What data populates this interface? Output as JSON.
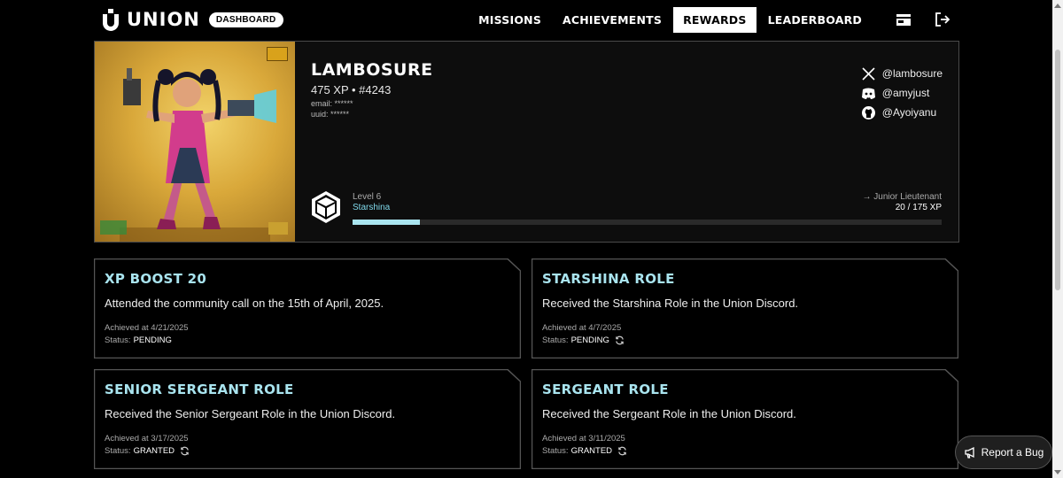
{
  "brand": {
    "name": "UNION",
    "tag": "DASHBOARD"
  },
  "nav": {
    "items": [
      {
        "label": "MISSIONS",
        "active": false
      },
      {
        "label": "ACHIEVEMENTS",
        "active": false
      },
      {
        "label": "REWARDS",
        "active": true
      },
      {
        "label": "LEADERBOARD",
        "active": false
      }
    ],
    "icons": [
      "wallet-icon",
      "logout-icon"
    ]
  },
  "profile": {
    "name": "LAMBOSURE",
    "xp_line": "475 XP • #4243",
    "email": "email: ******",
    "uuid": "uuid:  ******",
    "socials": [
      {
        "icon": "x-icon",
        "handle": "@lambosure"
      },
      {
        "icon": "discord-icon",
        "handle": "@amyjust"
      },
      {
        "icon": "github-icon",
        "handle": "@Ayoiyanu"
      }
    ],
    "level": "Level 6",
    "rank": "Starshina",
    "next_rank": "→ Junior Lieutenant",
    "xp_progress": "20 / 175 XP",
    "progress_fraction": 0.114
  },
  "cards": [
    {
      "title": "XP BOOST 20",
      "desc": "Attended the community call on the 15th of April, 2025.",
      "date": "Achieved at 4/21/2025",
      "status_label": "Status:",
      "status": "PENDING",
      "sync": false
    },
    {
      "title": "STARSHINA ROLE",
      "desc": "Received the Starshina Role in the Union Discord.",
      "date": "Achieved at 4/7/2025",
      "status_label": "Status:",
      "status": "PENDING",
      "sync": true
    },
    {
      "title": "SENIOR SERGEANT ROLE",
      "desc": "Received the Senior Sergeant Role in the Union Discord.",
      "date": "Achieved at 3/17/2025",
      "status_label": "Status:",
      "status": "GRANTED",
      "sync": true
    },
    {
      "title": "SERGEANT ROLE",
      "desc": "Received the Sergeant Role in the Union Discord.",
      "date": "Achieved at 3/11/2025",
      "status_label": "Status:",
      "status": "GRANTED",
      "sync": true
    }
  ],
  "report_bug": {
    "label": "Report a Bug"
  },
  "colors": {
    "accent": "#a9e4ef",
    "background": "#000000",
    "border": "#4a4a4a"
  }
}
